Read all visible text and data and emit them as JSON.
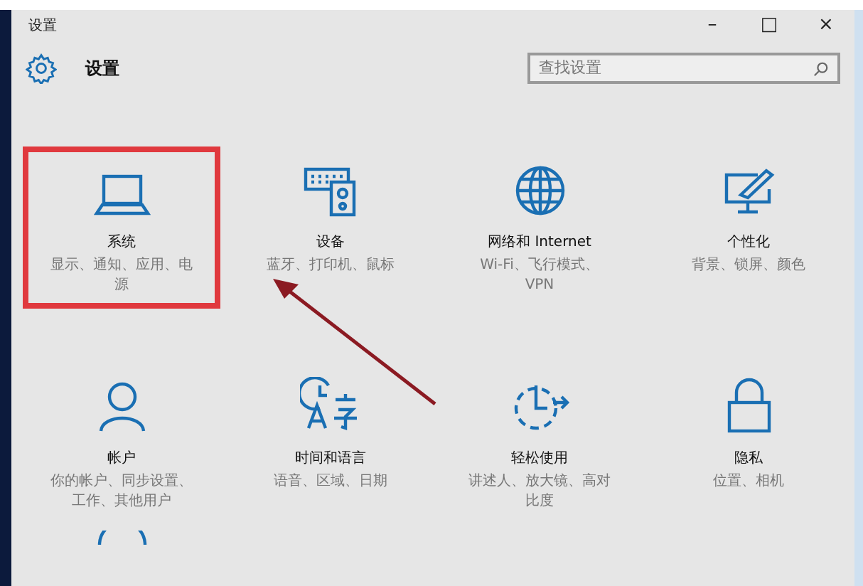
{
  "window": {
    "title": "设置",
    "controls": [
      "–",
      "□",
      "×"
    ]
  },
  "header": {
    "title": "设置",
    "search": {
      "placeholder": "查找设置"
    }
  },
  "tiles": [
    {
      "kind": "system",
      "title": "系统",
      "description": "显示、通知、应用、电源",
      "highlighted": true
    },
    {
      "kind": "devices",
      "title": "设备",
      "description": "蓝牙、打印机、鼠标",
      "highlighted": false
    },
    {
      "kind": "network",
      "title": "网络和 Internet",
      "description": "Wi-Fi、飞行模式、VPN",
      "highlighted": false
    },
    {
      "kind": "personalize",
      "title": "个性化",
      "description": "背景、锁屏、颜色",
      "highlighted": false
    },
    {
      "kind": "accounts",
      "title": "帐户",
      "description": "你的帐户、同步设置、工作、其他用户",
      "highlighted": false
    },
    {
      "kind": "time",
      "title": "时间和语言",
      "description": "语音、区域、日期",
      "highlighted": false
    },
    {
      "kind": "ease",
      "title": "轻松使用",
      "description": "讲述人、放大镜、高对比度",
      "highlighted": false
    },
    {
      "kind": "privacy",
      "title": "隐私",
      "description": "位置、相机",
      "highlighted": false
    }
  ],
  "cut_off_row": [
    {
      "kind": "update"
    }
  ]
}
